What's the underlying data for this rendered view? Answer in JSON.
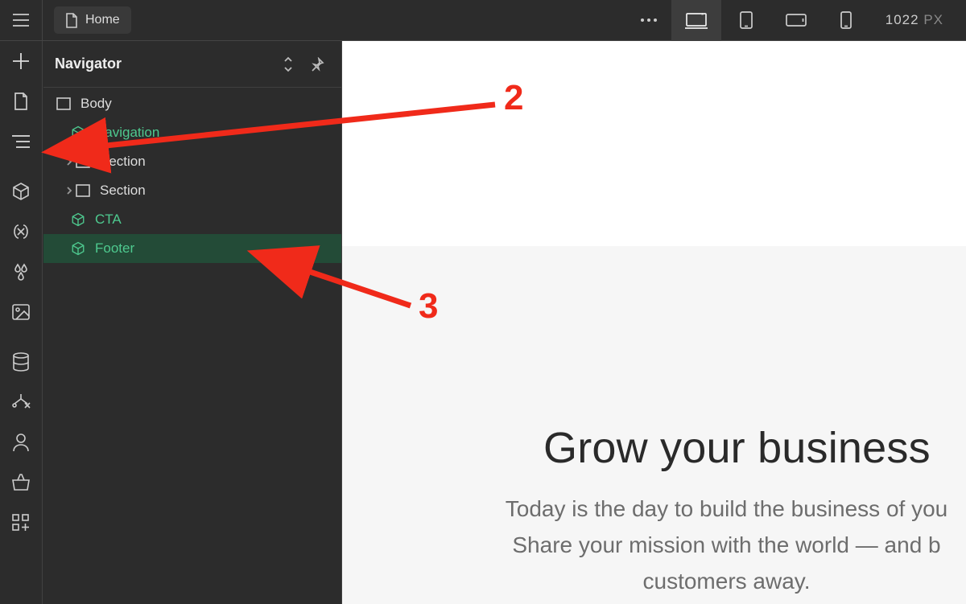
{
  "topBar": {
    "tab": "Home",
    "widthValue": "1022",
    "widthUnit": "PX"
  },
  "navigatorPanel": {
    "title": "Navigator"
  },
  "tree": {
    "body": "Body",
    "items": [
      {
        "label": "Navigation",
        "type": "component"
      },
      {
        "label": "Section",
        "type": "element",
        "hasChildren": true
      },
      {
        "label": "Section",
        "type": "element",
        "hasChildren": true
      },
      {
        "label": "CTA",
        "type": "component"
      },
      {
        "label": "Footer",
        "type": "component",
        "selected": true
      }
    ]
  },
  "canvas": {
    "heading": "Grow your business",
    "paragraphLine1": "Today is the day to build the business of you",
    "paragraphLine2": "Share your mission with the world — and b",
    "paragraphLine3": "customers away."
  },
  "annotations": {
    "a2": "2",
    "a3": "3"
  }
}
